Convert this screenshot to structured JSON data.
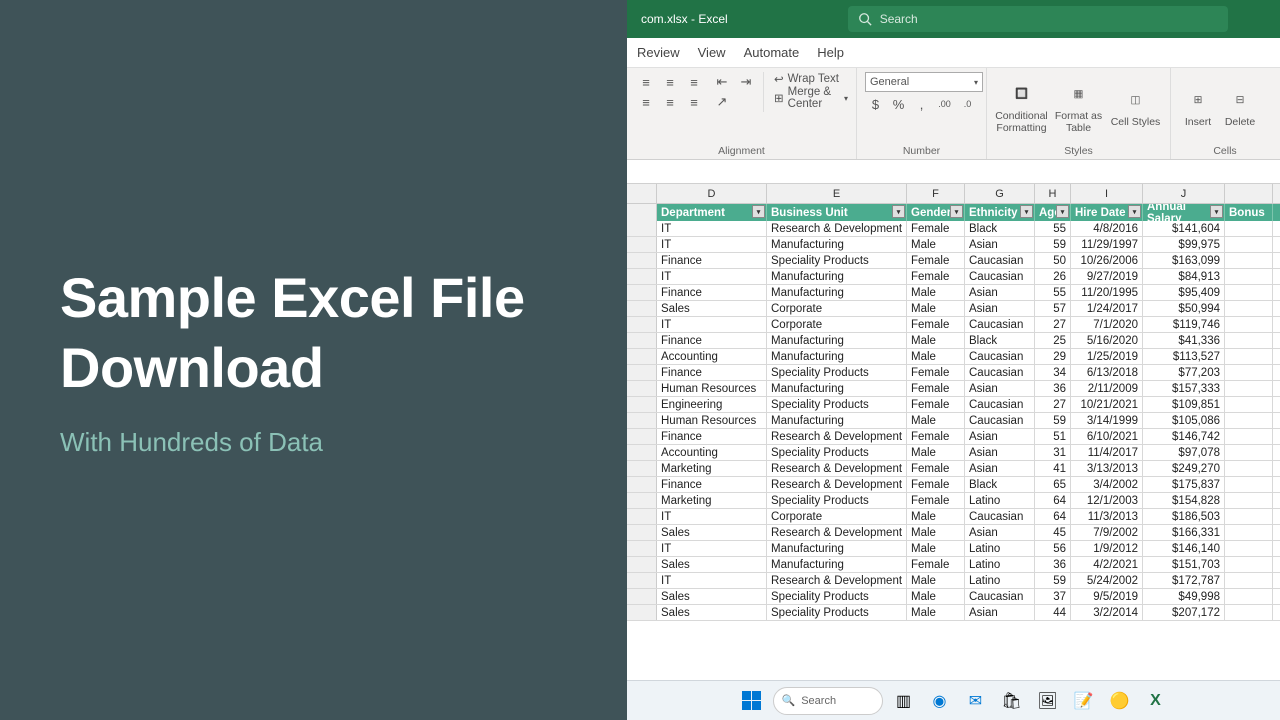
{
  "banner": {
    "title": "Sample Excel File Download",
    "subtitle": "With Hundreds of Data"
  },
  "titlebar": {
    "filename": "com.xlsx  -  Excel",
    "search_placeholder": "Search"
  },
  "tabs": {
    "review": "Review",
    "view": "View",
    "automate": "Automate",
    "help": "Help"
  },
  "ribbon": {
    "wrap": "Wrap Text",
    "merge": "Merge & Center",
    "align_label": "Alignment",
    "num_format": "General",
    "num_label": "Number",
    "cond": "Conditional Formatting",
    "table": "Format as Table",
    "cellstyles": "Cell Styles",
    "styles_label": "Styles",
    "insert": "Insert",
    "delete": "Delete",
    "cells_label": "Cells"
  },
  "cols": [
    "D",
    "E",
    "F",
    "G",
    "H",
    "I",
    "J"
  ],
  "headers": {
    "dept": "Department",
    "bu": "Business Unit",
    "gender": "Gender",
    "eth": "Ethnicity",
    "age": "Age",
    "hire": "Hire Date",
    "salary": "Annual Salary",
    "bonus": "Bonus"
  },
  "rows": [
    {
      "d": "IT",
      "e": "Research & Development",
      "f": "Female",
      "g": "Black",
      "h": "55",
      "i": "4/8/2016",
      "j": "$141,604"
    },
    {
      "d": "IT",
      "e": "Manufacturing",
      "f": "Male",
      "g": "Asian",
      "h": "59",
      "i": "11/29/1997",
      "j": "$99,975"
    },
    {
      "d": "Finance",
      "e": "Speciality Products",
      "f": "Female",
      "g": "Caucasian",
      "h": "50",
      "i": "10/26/2006",
      "j": "$163,099"
    },
    {
      "d": "IT",
      "e": "Manufacturing",
      "f": "Female",
      "g": "Caucasian",
      "h": "26",
      "i": "9/27/2019",
      "j": "$84,913"
    },
    {
      "d": "Finance",
      "e": "Manufacturing",
      "f": "Male",
      "g": "Asian",
      "h": "55",
      "i": "11/20/1995",
      "j": "$95,409"
    },
    {
      "d": "Sales",
      "e": "Corporate",
      "f": "Male",
      "g": "Asian",
      "h": "57",
      "i": "1/24/2017",
      "j": "$50,994"
    },
    {
      "d": "IT",
      "e": "Corporate",
      "f": "Female",
      "g": "Caucasian",
      "h": "27",
      "i": "7/1/2020",
      "j": "$119,746"
    },
    {
      "d": "Finance",
      "e": "Manufacturing",
      "f": "Male",
      "g": "Black",
      "h": "25",
      "i": "5/16/2020",
      "j": "$41,336"
    },
    {
      "d": "Accounting",
      "e": "Manufacturing",
      "f": "Male",
      "g": "Caucasian",
      "h": "29",
      "i": "1/25/2019",
      "j": "$113,527"
    },
    {
      "d": "Finance",
      "e": "Speciality Products",
      "f": "Female",
      "g": "Caucasian",
      "h": "34",
      "i": "6/13/2018",
      "j": "$77,203"
    },
    {
      "d": "Human Resources",
      "e": "Manufacturing",
      "f": "Female",
      "g": "Asian",
      "h": "36",
      "i": "2/11/2009",
      "j": "$157,333"
    },
    {
      "d": "Engineering",
      "e": "Speciality Products",
      "f": "Female",
      "g": "Caucasian",
      "h": "27",
      "i": "10/21/2021",
      "j": "$109,851"
    },
    {
      "d": "Human Resources",
      "e": "Manufacturing",
      "f": "Male",
      "g": "Caucasian",
      "h": "59",
      "i": "3/14/1999",
      "j": "$105,086"
    },
    {
      "d": "Finance",
      "e": "Research & Development",
      "f": "Female",
      "g": "Asian",
      "h": "51",
      "i": "6/10/2021",
      "j": "$146,742"
    },
    {
      "d": "Accounting",
      "e": "Speciality Products",
      "f": "Male",
      "g": "Asian",
      "h": "31",
      "i": "11/4/2017",
      "j": "$97,078"
    },
    {
      "d": "Marketing",
      "e": "Research & Development",
      "f": "Female",
      "g": "Asian",
      "h": "41",
      "i": "3/13/2013",
      "j": "$249,270"
    },
    {
      "d": "Finance",
      "e": "Research & Development",
      "f": "Female",
      "g": "Black",
      "h": "65",
      "i": "3/4/2002",
      "j": "$175,837"
    },
    {
      "d": "Marketing",
      "e": "Speciality Products",
      "f": "Female",
      "g": "Latino",
      "h": "64",
      "i": "12/1/2003",
      "j": "$154,828"
    },
    {
      "d": "IT",
      "e": "Corporate",
      "f": "Male",
      "g": "Caucasian",
      "h": "64",
      "i": "11/3/2013",
      "j": "$186,503"
    },
    {
      "d": "Sales",
      "e": "Research & Development",
      "f": "Male",
      "g": "Asian",
      "h": "45",
      "i": "7/9/2002",
      "j": "$166,331"
    },
    {
      "d": "IT",
      "e": "Manufacturing",
      "f": "Male",
      "g": "Latino",
      "h": "56",
      "i": "1/9/2012",
      "j": "$146,140"
    },
    {
      "d": "Sales",
      "e": "Manufacturing",
      "f": "Female",
      "g": "Latino",
      "h": "36",
      "i": "4/2/2021",
      "j": "$151,703"
    },
    {
      "d": "IT",
      "e": "Research & Development",
      "f": "Male",
      "g": "Latino",
      "h": "59",
      "i": "5/24/2002",
      "j": "$172,787"
    },
    {
      "d": "Sales",
      "e": "Speciality Products",
      "f": "Male",
      "g": "Caucasian",
      "h": "37",
      "i": "9/5/2019",
      "j": "$49,998"
    },
    {
      "d": "Sales",
      "e": "Speciality Products",
      "f": "Male",
      "g": "Asian",
      "h": "44",
      "i": "3/2/2014",
      "j": "$207,172"
    }
  ],
  "taskbar": {
    "search": "Search"
  }
}
